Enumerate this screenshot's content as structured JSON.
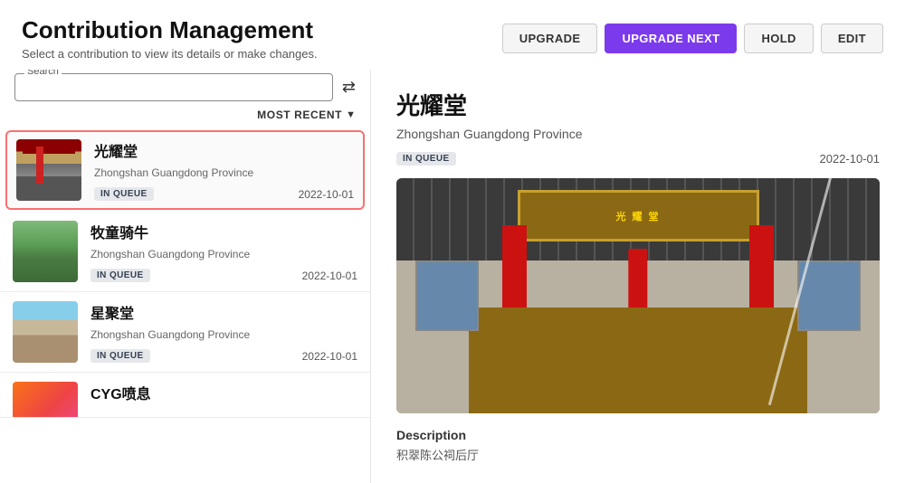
{
  "page": {
    "title": "Contribution Management",
    "subtitle": "Select a contribution to view its details or make changes."
  },
  "toolbar": {
    "upgrade_label": "UPGRADE",
    "upgrade_next_label": "UPGRADE NEXT",
    "hold_label": "HOLD",
    "edit_label": "EDIT"
  },
  "search": {
    "label": "Search",
    "placeholder": ""
  },
  "filter": {
    "label": "MOST RECENT",
    "chevron": "▼"
  },
  "list": {
    "items": [
      {
        "title": "光耀堂",
        "subtitle": "Zhongshan Guangdong Province",
        "status": "IN QUEUE",
        "date": "2022-10-01",
        "selected": true,
        "thumb_type": "temple1"
      },
      {
        "title": "牧童骑牛",
        "subtitle": "Zhongshan Guangdong Province",
        "status": "IN QUEUE",
        "date": "2022-10-01",
        "selected": false,
        "thumb_type": "forest"
      },
      {
        "title": "星聚堂",
        "subtitle": "Zhongshan Guangdong Province",
        "status": "IN QUEUE",
        "date": "2022-10-01",
        "selected": false,
        "thumb_type": "archway"
      },
      {
        "title": "CYG喷息",
        "subtitle": "",
        "status": "",
        "date": "",
        "selected": false,
        "thumb_type": "gradient"
      }
    ]
  },
  "detail": {
    "title": "光耀堂",
    "location": "Zhongshan Guangdong Province",
    "status": "IN QUEUE",
    "date": "2022-10-01",
    "description_label": "Description",
    "description_text": "积翠陈公祠后厅"
  }
}
